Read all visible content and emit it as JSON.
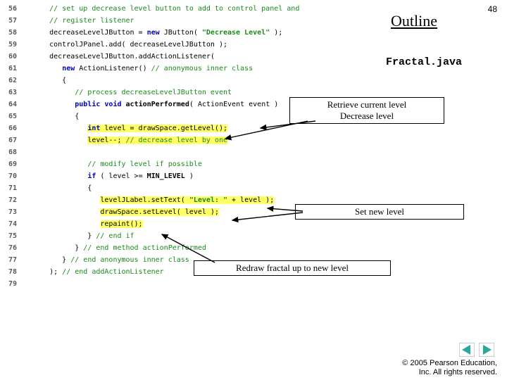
{
  "slide_number": "48",
  "outline_title": "Outline",
  "filename": "Fractal.java",
  "code_lines": [
    {
      "n": "56",
      "segs": [
        {
          "t": "      ",
          "c": ""
        },
        {
          "t": "// set up decrease level button to add to control panel and",
          "c": "c-comment"
        }
      ]
    },
    {
      "n": "57",
      "segs": [
        {
          "t": "      ",
          "c": ""
        },
        {
          "t": "// register listener",
          "c": "c-comment"
        }
      ]
    },
    {
      "n": "58",
      "segs": [
        {
          "t": "      decreaseLevelJButton = ",
          "c": "c-id"
        },
        {
          "t": "new",
          "c": "c-key"
        },
        {
          "t": " JButton( ",
          "c": "c-id"
        },
        {
          "t": "\"Decrease Level\"",
          "c": "c-str"
        },
        {
          "t": " );",
          "c": "c-id"
        }
      ]
    },
    {
      "n": "59",
      "segs": [
        {
          "t": "      controlJPanel.add( decreaseLevelJButton );",
          "c": "c-id"
        }
      ]
    },
    {
      "n": "60",
      "segs": [
        {
          "t": "      decreaseLevelJButton.addActionListener(",
          "c": "c-id"
        }
      ]
    },
    {
      "n": "61",
      "segs": [
        {
          "t": "         ",
          "c": ""
        },
        {
          "t": "new",
          "c": "c-key"
        },
        {
          "t": " ActionListener() ",
          "c": "c-id"
        },
        {
          "t": "// anonymous inner class",
          "c": "c-comment"
        }
      ]
    },
    {
      "n": "62",
      "segs": [
        {
          "t": "         {",
          "c": "c-id"
        }
      ]
    },
    {
      "n": "63",
      "segs": [
        {
          "t": "            ",
          "c": ""
        },
        {
          "t": "// process decreaseLevelJButton event",
          "c": "c-comment"
        }
      ]
    },
    {
      "n": "64",
      "segs": [
        {
          "t": "            ",
          "c": ""
        },
        {
          "t": "public",
          "c": "c-key"
        },
        {
          "t": " ",
          "c": ""
        },
        {
          "t": "void",
          "c": "c-key"
        },
        {
          "t": " ",
          "c": ""
        },
        {
          "t": "actionPerformed",
          "c": "c-bold"
        },
        {
          "t": "( ActionEvent event )",
          "c": "c-id"
        }
      ]
    },
    {
      "n": "65",
      "segs": [
        {
          "t": "            {",
          "c": "c-id"
        }
      ]
    },
    {
      "n": "66",
      "segs": [
        {
          "t": "               ",
          "c": ""
        },
        {
          "t": "int",
          "c": "c-key hl"
        },
        {
          "t": " level = drawSpace.getLevel();",
          "c": "c-id hl"
        }
      ]
    },
    {
      "n": "67",
      "segs": [
        {
          "t": "               ",
          "c": ""
        },
        {
          "t": "level--; ",
          "c": "c-id hl"
        },
        {
          "t": "// decrease level by one",
          "c": "c-comment hl"
        }
      ]
    },
    {
      "n": "68",
      "segs": [
        {
          "t": "",
          "c": ""
        }
      ]
    },
    {
      "n": "69",
      "segs": [
        {
          "t": "               ",
          "c": ""
        },
        {
          "t": "// modify level if possible",
          "c": "c-comment"
        }
      ]
    },
    {
      "n": "70",
      "segs": [
        {
          "t": "               ",
          "c": ""
        },
        {
          "t": "if",
          "c": "c-key"
        },
        {
          "t": " ( level >= ",
          "c": "c-id"
        },
        {
          "t": "MIN_LEVEL",
          "c": "c-bold"
        },
        {
          "t": " )",
          "c": "c-id"
        }
      ]
    },
    {
      "n": "71",
      "segs": [
        {
          "t": "               {",
          "c": "c-id"
        }
      ]
    },
    {
      "n": "72",
      "segs": [
        {
          "t": "                  ",
          "c": ""
        },
        {
          "t": "levelJLabel.setText( ",
          "c": "c-id hl"
        },
        {
          "t": "\"Level: \"",
          "c": "c-str hl"
        },
        {
          "t": " + level );",
          "c": "c-id hl"
        }
      ]
    },
    {
      "n": "73",
      "segs": [
        {
          "t": "                  ",
          "c": ""
        },
        {
          "t": "drawSpace.setLevel( level );",
          "c": "c-id hl"
        }
      ]
    },
    {
      "n": "74",
      "segs": [
        {
          "t": "                  ",
          "c": ""
        },
        {
          "t": "repaint();",
          "c": "c-id hl"
        }
      ]
    },
    {
      "n": "75",
      "segs": [
        {
          "t": "               } ",
          "c": "c-id"
        },
        {
          "t": "// end if",
          "c": "c-comment"
        }
      ]
    },
    {
      "n": "76",
      "segs": [
        {
          "t": "            } ",
          "c": "c-id"
        },
        {
          "t": "// end method actionPerformed",
          "c": "c-comment"
        }
      ]
    },
    {
      "n": "77",
      "segs": [
        {
          "t": "         } ",
          "c": "c-id"
        },
        {
          "t": "// end anonymous inner class",
          "c": "c-comment"
        }
      ]
    },
    {
      "n": "78",
      "segs": [
        {
          "t": "      ); ",
          "c": "c-id"
        },
        {
          "t": "// end addActionListener",
          "c": "c-comment"
        }
      ]
    },
    {
      "n": "79",
      "segs": [
        {
          "t": "",
          "c": ""
        }
      ]
    }
  ],
  "callouts": {
    "c1_line1": "Retrieve current level",
    "c1_line2": "Decrease level",
    "c2": "Set new level",
    "c3": "Redraw fractal up to new level"
  },
  "copyright_line1": "© 2005 Pearson Education,",
  "copyright_line2": "Inc.  All rights reserved.",
  "icons": {
    "prev": "prev-triangle",
    "next": "next-triangle"
  }
}
